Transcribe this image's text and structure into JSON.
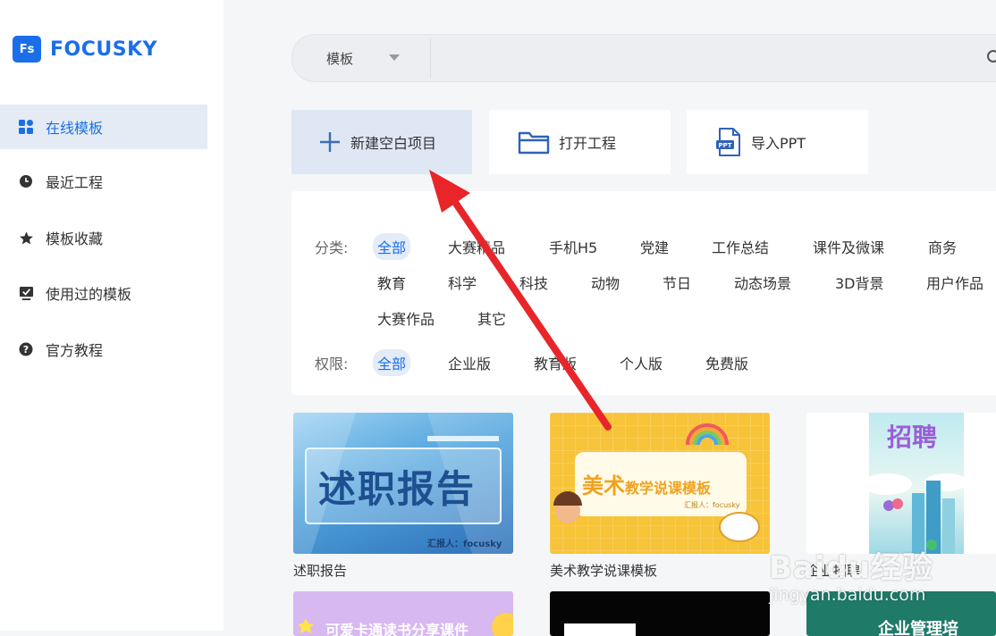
{
  "brand": {
    "badge": "Fs",
    "name": "FOCUSKY",
    "color": "#1a6fe8"
  },
  "sidebar": {
    "items": [
      {
        "label": "在线模板",
        "icon": "grid-icon",
        "active": true
      },
      {
        "label": "最近工程",
        "icon": "clock-icon",
        "active": false
      },
      {
        "label": "模板收藏",
        "icon": "star-icon",
        "active": false
      },
      {
        "label": "使用过的模板",
        "icon": "monitor-check-icon",
        "active": false
      },
      {
        "label": "官方教程",
        "icon": "help-icon",
        "active": false
      }
    ]
  },
  "search": {
    "category": "模板",
    "placeholder": ""
  },
  "actions": {
    "new_blank": "新建空白项目",
    "open_project": "打开工程",
    "import_ppt": "导入PPT"
  },
  "filters": {
    "category_label": "分类:",
    "categories": [
      "全部",
      "大赛精品",
      "手机H5",
      "党建",
      "工作总结",
      "课件及微课",
      "商务",
      "教育",
      "科学",
      "科技",
      "动物",
      "节日",
      "动态场景",
      "3D背景",
      "用户作品",
      "大赛作品",
      "其它"
    ],
    "permission_label": "权限:",
    "permissions": [
      "全部",
      "企业版",
      "教育版",
      "个人版",
      "免费版"
    ]
  },
  "templates": [
    {
      "caption": "述职报告",
      "thumb_title": "述职报告",
      "thumb_sub": "汇报人：focusky"
    },
    {
      "caption": "美术教学说课模板",
      "thumb_title": "美术",
      "thumb_title2": "教学说课模板",
      "thumb_sub": "汇报人：focusky"
    },
    {
      "caption": "企业招聘",
      "thumb_title": "招聘"
    },
    {
      "thumb_title": "可爱卡通读书分享课件"
    },
    {
      "thumb_title": ""
    },
    {
      "thumb_title": "企业管理培"
    }
  ],
  "watermark": {
    "main": "Baidu经验",
    "sub": "jingyan.baidu.com"
  },
  "colors": {
    "accent": "#1a6fe8",
    "arrow": "#e8262a"
  }
}
